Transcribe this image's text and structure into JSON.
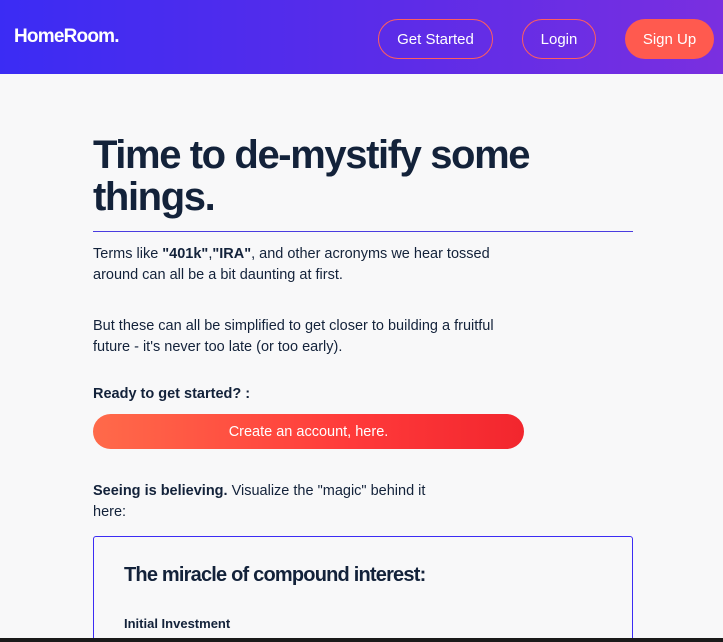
{
  "navbar": {
    "logo": "HomeRoom.",
    "get_started_label": "Get Started",
    "login_label": "Login",
    "signup_label": "Sign Up"
  },
  "hero": {
    "headline": "Time to de-mystify some things.",
    "p1_prefix": "Terms like ",
    "p1_term1": "\"401k\"",
    "p1_comma": ",",
    "p1_term2": "\"IRA\"",
    "p1_suffix": ", and other acronyms we hear tossed around can all be a bit daunting at first.",
    "p2": "But these can all be simplified to get closer to building a fruitful future - it's never too late (or too early).",
    "ready_label": "Ready to get started? :",
    "cta_label": "Create an account, here.",
    "seeing_bold": "Seeing is believing.",
    "seeing_rest": " Visualize the \"magic\" behind it here:"
  },
  "calculator": {
    "title": "The miracle of compound interest:",
    "initial_investment_label": "Initial Investment"
  },
  "colors": {
    "nav_gradient_start": "#3b2cf4",
    "accent": "#ff5a4f",
    "text": "#13223a"
  }
}
